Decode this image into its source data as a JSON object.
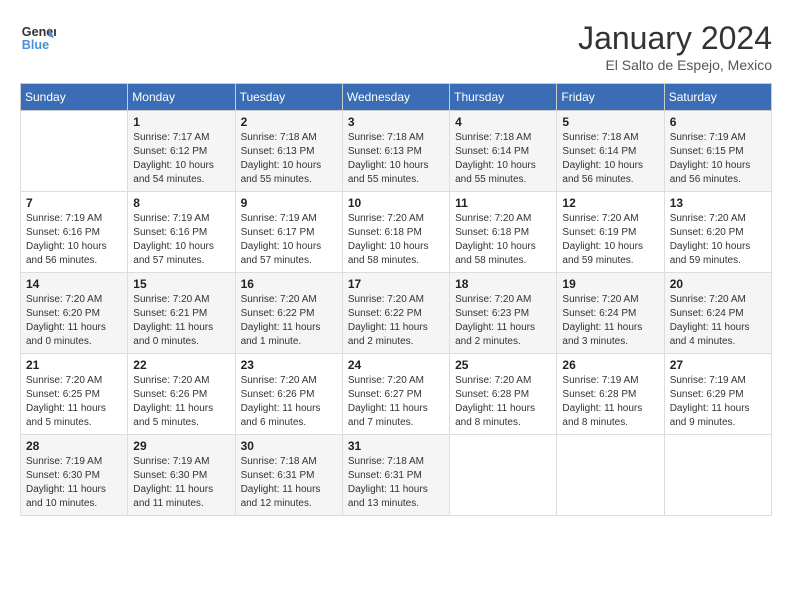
{
  "header": {
    "logo_line1": "General",
    "logo_line2": "Blue",
    "month": "January 2024",
    "location": "El Salto de Espejo, Mexico"
  },
  "weekdays": [
    "Sunday",
    "Monday",
    "Tuesday",
    "Wednesday",
    "Thursday",
    "Friday",
    "Saturday"
  ],
  "weeks": [
    [
      {
        "day": "",
        "info": ""
      },
      {
        "day": "1",
        "info": "Sunrise: 7:17 AM\nSunset: 6:12 PM\nDaylight: 10 hours\nand 54 minutes."
      },
      {
        "day": "2",
        "info": "Sunrise: 7:18 AM\nSunset: 6:13 PM\nDaylight: 10 hours\nand 55 minutes."
      },
      {
        "day": "3",
        "info": "Sunrise: 7:18 AM\nSunset: 6:13 PM\nDaylight: 10 hours\nand 55 minutes."
      },
      {
        "day": "4",
        "info": "Sunrise: 7:18 AM\nSunset: 6:14 PM\nDaylight: 10 hours\nand 55 minutes."
      },
      {
        "day": "5",
        "info": "Sunrise: 7:18 AM\nSunset: 6:14 PM\nDaylight: 10 hours\nand 56 minutes."
      },
      {
        "day": "6",
        "info": "Sunrise: 7:19 AM\nSunset: 6:15 PM\nDaylight: 10 hours\nand 56 minutes."
      }
    ],
    [
      {
        "day": "7",
        "info": "Sunrise: 7:19 AM\nSunset: 6:16 PM\nDaylight: 10 hours\nand 56 minutes."
      },
      {
        "day": "8",
        "info": "Sunrise: 7:19 AM\nSunset: 6:16 PM\nDaylight: 10 hours\nand 57 minutes."
      },
      {
        "day": "9",
        "info": "Sunrise: 7:19 AM\nSunset: 6:17 PM\nDaylight: 10 hours\nand 57 minutes."
      },
      {
        "day": "10",
        "info": "Sunrise: 7:20 AM\nSunset: 6:18 PM\nDaylight: 10 hours\nand 58 minutes."
      },
      {
        "day": "11",
        "info": "Sunrise: 7:20 AM\nSunset: 6:18 PM\nDaylight: 10 hours\nand 58 minutes."
      },
      {
        "day": "12",
        "info": "Sunrise: 7:20 AM\nSunset: 6:19 PM\nDaylight: 10 hours\nand 59 minutes."
      },
      {
        "day": "13",
        "info": "Sunrise: 7:20 AM\nSunset: 6:20 PM\nDaylight: 10 hours\nand 59 minutes."
      }
    ],
    [
      {
        "day": "14",
        "info": "Sunrise: 7:20 AM\nSunset: 6:20 PM\nDaylight: 11 hours\nand 0 minutes."
      },
      {
        "day": "15",
        "info": "Sunrise: 7:20 AM\nSunset: 6:21 PM\nDaylight: 11 hours\nand 0 minutes."
      },
      {
        "day": "16",
        "info": "Sunrise: 7:20 AM\nSunset: 6:22 PM\nDaylight: 11 hours\nand 1 minute."
      },
      {
        "day": "17",
        "info": "Sunrise: 7:20 AM\nSunset: 6:22 PM\nDaylight: 11 hours\nand 2 minutes."
      },
      {
        "day": "18",
        "info": "Sunrise: 7:20 AM\nSunset: 6:23 PM\nDaylight: 11 hours\nand 2 minutes."
      },
      {
        "day": "19",
        "info": "Sunrise: 7:20 AM\nSunset: 6:24 PM\nDaylight: 11 hours\nand 3 minutes."
      },
      {
        "day": "20",
        "info": "Sunrise: 7:20 AM\nSunset: 6:24 PM\nDaylight: 11 hours\nand 4 minutes."
      }
    ],
    [
      {
        "day": "21",
        "info": "Sunrise: 7:20 AM\nSunset: 6:25 PM\nDaylight: 11 hours\nand 5 minutes."
      },
      {
        "day": "22",
        "info": "Sunrise: 7:20 AM\nSunset: 6:26 PM\nDaylight: 11 hours\nand 5 minutes."
      },
      {
        "day": "23",
        "info": "Sunrise: 7:20 AM\nSunset: 6:26 PM\nDaylight: 11 hours\nand 6 minutes."
      },
      {
        "day": "24",
        "info": "Sunrise: 7:20 AM\nSunset: 6:27 PM\nDaylight: 11 hours\nand 7 minutes."
      },
      {
        "day": "25",
        "info": "Sunrise: 7:20 AM\nSunset: 6:28 PM\nDaylight: 11 hours\nand 8 minutes."
      },
      {
        "day": "26",
        "info": "Sunrise: 7:19 AM\nSunset: 6:28 PM\nDaylight: 11 hours\nand 8 minutes."
      },
      {
        "day": "27",
        "info": "Sunrise: 7:19 AM\nSunset: 6:29 PM\nDaylight: 11 hours\nand 9 minutes."
      }
    ],
    [
      {
        "day": "28",
        "info": "Sunrise: 7:19 AM\nSunset: 6:30 PM\nDaylight: 11 hours\nand 10 minutes."
      },
      {
        "day": "29",
        "info": "Sunrise: 7:19 AM\nSunset: 6:30 PM\nDaylight: 11 hours\nand 11 minutes."
      },
      {
        "day": "30",
        "info": "Sunrise: 7:18 AM\nSunset: 6:31 PM\nDaylight: 11 hours\nand 12 minutes."
      },
      {
        "day": "31",
        "info": "Sunrise: 7:18 AM\nSunset: 6:31 PM\nDaylight: 11 hours\nand 13 minutes."
      },
      {
        "day": "",
        "info": ""
      },
      {
        "day": "",
        "info": ""
      },
      {
        "day": "",
        "info": ""
      }
    ]
  ]
}
